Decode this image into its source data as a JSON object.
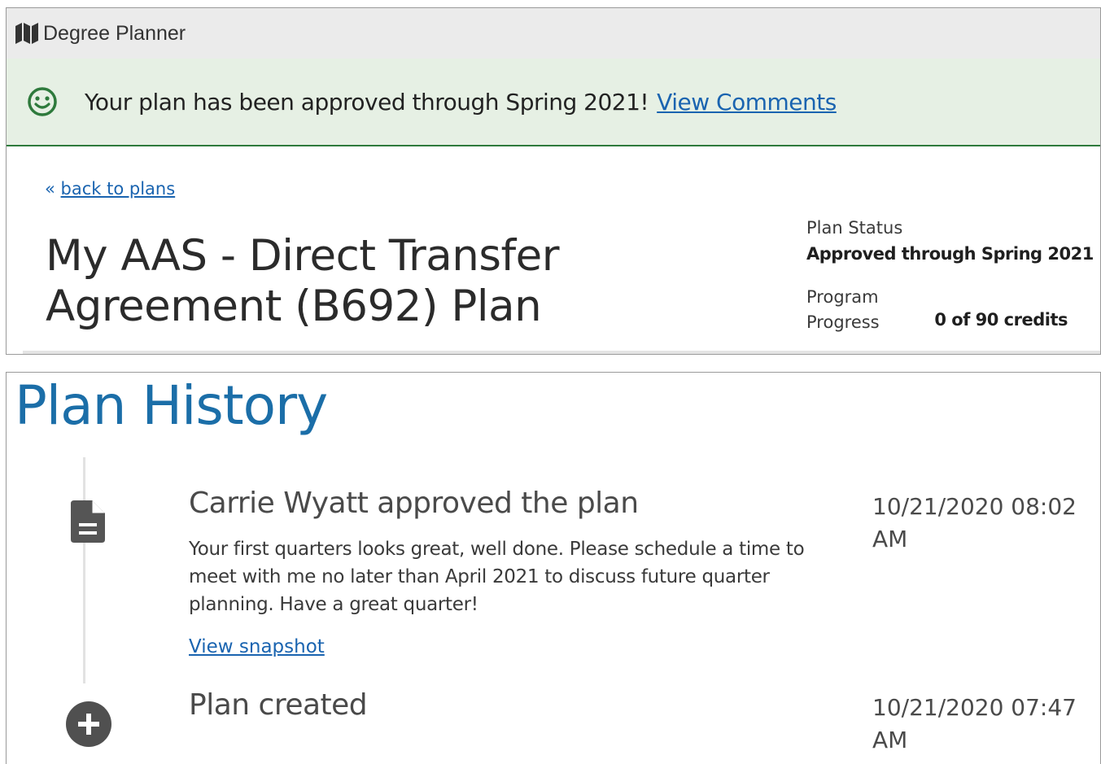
{
  "app": {
    "title": "Degree Planner"
  },
  "banner": {
    "message": "Your plan has been approved through Spring 2021!",
    "link_label": "View Comments",
    "accent_color": "#2e7a3c"
  },
  "plan": {
    "back_arrow": "«",
    "back_label": "back to plans",
    "title": "My AAS - Direct Transfer Agreement (B692) Plan",
    "status_label": "Plan Status",
    "status_value": "Approved through Spring 2021",
    "progress_label": "Program Progress",
    "progress_value": "0 of 90 credits"
  },
  "history": {
    "title": "Plan History",
    "entries": [
      {
        "icon": "document-icon",
        "heading": "Carrie Wyatt approved the plan",
        "body": "Your first quarters looks great, well done. Please schedule a time to meet with me no later than April 2021 to discuss future quarter planning. Have a great quarter!",
        "link_label": "View snapshot",
        "timestamp": "10/21/2020 08:02 AM"
      },
      {
        "icon": "plus-circle-icon",
        "heading": "Plan created",
        "timestamp": "10/21/2020 07:47 AM"
      }
    ]
  },
  "colors": {
    "link": "#1a64b0",
    "heading_blue": "#1b6ea8",
    "banner_bg": "#e6f0e4"
  }
}
